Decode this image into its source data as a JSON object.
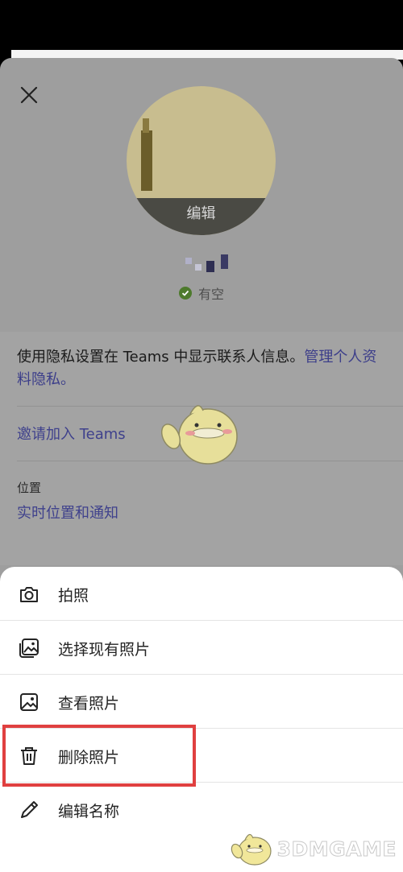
{
  "profile": {
    "edit_label": "编辑",
    "status_text": "有空",
    "privacy_text": "使用隐私设置在 Teams 中显示联系人信息。",
    "privacy_link": "管理个人资料隐私。",
    "invite_link": "邀请加入 Teams",
    "location_label": "位置",
    "location_link": "实时位置和通知"
  },
  "sheet": {
    "items": [
      {
        "label": "拍照",
        "icon": "camera-icon"
      },
      {
        "label": "选择现有照片",
        "icon": "gallery-icon"
      },
      {
        "label": "查看照片",
        "icon": "image-icon"
      },
      {
        "label": "删除照片",
        "icon": "trash-icon"
      },
      {
        "label": "编辑名称",
        "icon": "pencil-icon"
      }
    ]
  },
  "watermark": "3DMGAME",
  "colors": {
    "link": "#3f418c",
    "status_available": "#4d7a2c",
    "highlight": "#e04040"
  }
}
